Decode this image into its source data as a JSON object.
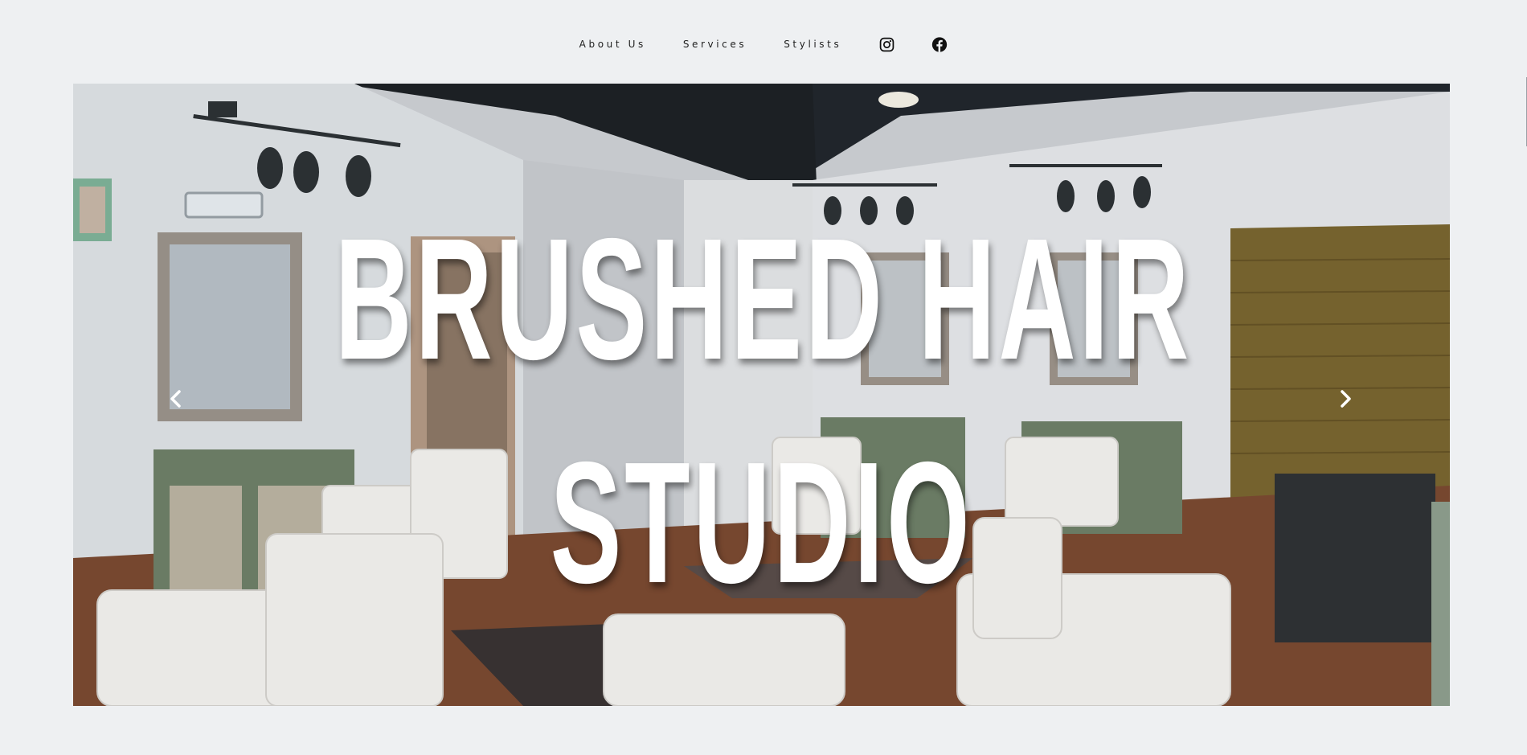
{
  "nav": {
    "items": [
      {
        "label": "About Us"
      },
      {
        "label": "Services"
      },
      {
        "label": "Stylists"
      }
    ],
    "social": [
      {
        "icon": "instagram-icon"
      },
      {
        "icon": "facebook-icon"
      }
    ]
  },
  "hero": {
    "title_line1": "BRUSHED HAIR",
    "title_line2": "STUDIO",
    "prev_icon": "chevron-left-icon",
    "next_icon": "chevron-right-icon",
    "image_subject": "salon interior with white styling chairs"
  },
  "colors": {
    "page_bg": "#eef0f2",
    "nav_text": "#1e1e1e",
    "title_text": "#ffffff"
  }
}
